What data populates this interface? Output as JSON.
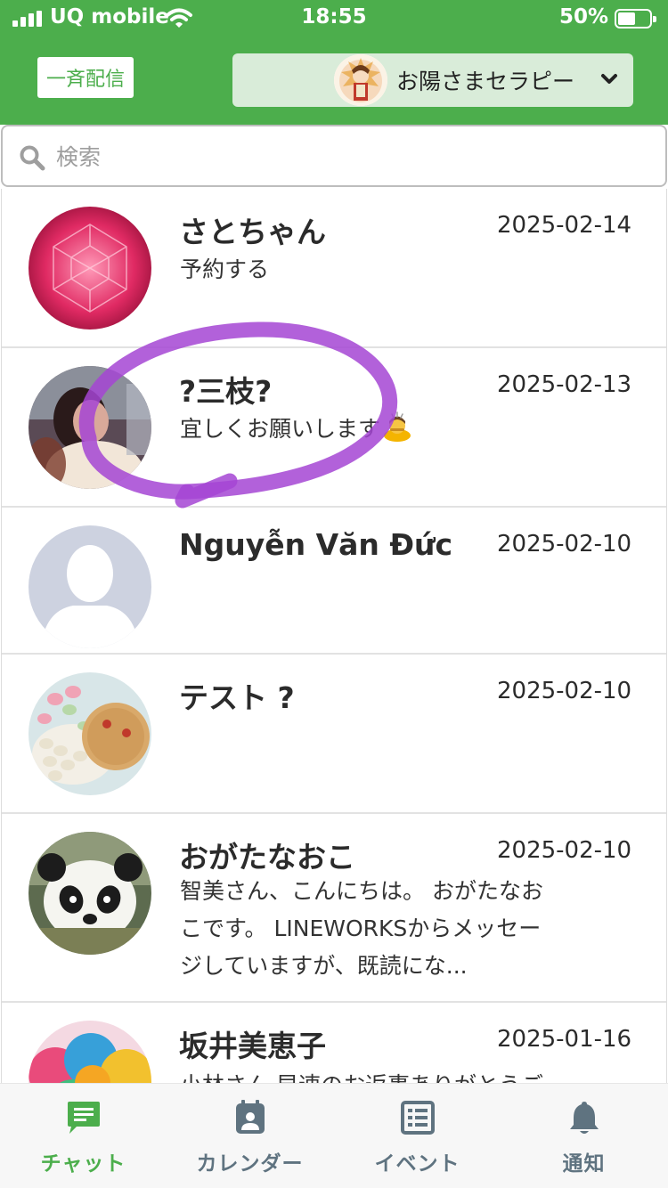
{
  "status_bar": {
    "carrier": "UQ mobile",
    "time": "18:55",
    "battery": "50%",
    "battery_level": 0.5
  },
  "header": {
    "broadcast_label": "一斉配信",
    "account_name": "お陽さまセラピー",
    "accent_color": "#4cae4c"
  },
  "search": {
    "placeholder": "検索"
  },
  "chats": [
    {
      "name": "さとちゃん",
      "date": "2025-02-14",
      "message": "予約する"
    },
    {
      "name": "?三枝?",
      "date": "2025-02-13",
      "message": "宜しくお願いします",
      "emoji": "person-bowing-emoji"
    },
    {
      "name": "Nguyễn Văn Đức",
      "date": "2025-02-10",
      "message": ""
    },
    {
      "name": "テスト ?",
      "date": "2025-02-10",
      "message": ""
    },
    {
      "name": "おがたなおこ",
      "date": "2025-02-10",
      "message_lines": [
        "智美さん、こんにちは。 おがたなお",
        "こです。 LINEWORKSからメッセー",
        "ジしていますが、既読にな..."
      ]
    },
    {
      "name": "坂井美恵子",
      "date": "2025-01-16",
      "message": "小林さん 早速のお返事ありがとうご"
    }
  ],
  "tabs": [
    {
      "label": "チャット",
      "icon": "chat-icon",
      "active": true
    },
    {
      "label": "カレンダー",
      "icon": "calendar-icon",
      "active": false
    },
    {
      "label": "イベント",
      "icon": "event-list-icon",
      "active": false
    },
    {
      "label": "通知",
      "icon": "bell-icon",
      "active": false
    }
  ]
}
